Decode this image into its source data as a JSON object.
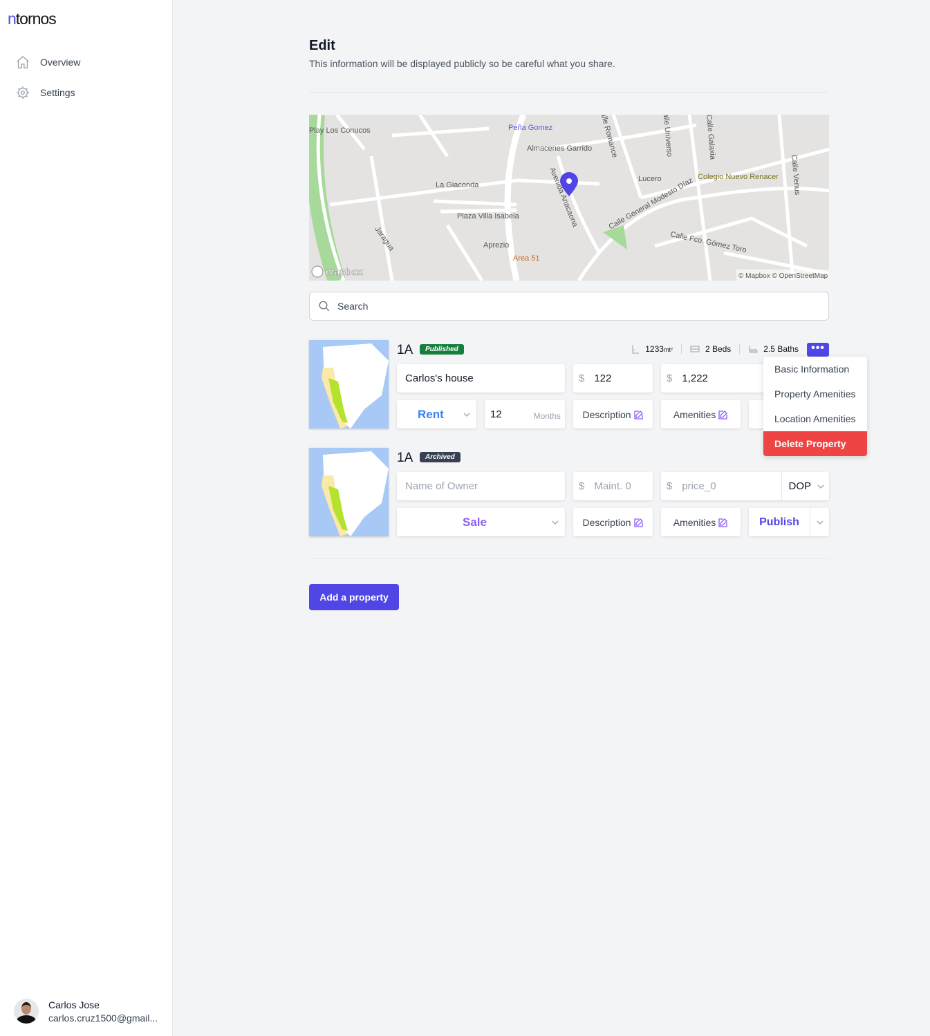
{
  "app": {
    "logo_n": "n",
    "logo_rest": "tornos"
  },
  "sidebar": {
    "items": [
      {
        "label": "Overview",
        "icon": "home-icon"
      },
      {
        "label": "Settings",
        "icon": "gear-icon"
      }
    ]
  },
  "user": {
    "name": "Carlos Jose",
    "email": "carlos.cruz1500@gmail..."
  },
  "header": {
    "title": "Edit",
    "subtitle": "This information will be displayed publicly so be careful what you share."
  },
  "map": {
    "labels": [
      "Play Los Conucos",
      "Peña Gomez",
      "Almacenes Garrido",
      "Calle Romance",
      "Calle Universo",
      "Calle Galaxia",
      "Calle Venus",
      "La Giaconda",
      "Avenida Anacaona",
      "Lucero",
      "Colegio Nuevo Renacer",
      "Calle General Modesto Díaz",
      "Plaza Villa Isabela",
      "Jaragua",
      "Aprezio",
      "Area 51",
      "Calle Fco. Gómez Toro"
    ],
    "logo": "mapbox",
    "attribution": "© Mapbox © OpenStreetMap",
    "pin_color": "#4f46e5"
  },
  "search": {
    "placeholder": "Search"
  },
  "properties": [
    {
      "unit": "1A",
      "status": "Published",
      "status_color": "#15803d",
      "area": "1233",
      "area_unit": "mt²",
      "beds": "2 Beds",
      "baths": "2.5 Baths",
      "name": "Carlos's house",
      "maintenance": "122",
      "price": "1,222",
      "type": "Rent",
      "duration": "12",
      "duration_unit": "Months",
      "description_label": "Description",
      "amenities_label": "Amenities"
    },
    {
      "unit": "1A",
      "status": "Archived",
      "status_color": "#374151",
      "name_placeholder": "Name of Owner",
      "maintenance_placeholder": "Maint. 0",
      "price_placeholder": "price_0",
      "currency": "DOP",
      "type": "Sale",
      "description_label": "Description",
      "amenities_label": "Amenities",
      "publish_label": "Publish"
    }
  ],
  "currency_symbol": "$",
  "more_label": "•••",
  "menu": {
    "items": [
      "Basic Information",
      "Property Amenities",
      "Location Amenities"
    ],
    "delete": "Delete Property"
  },
  "add_button": "Add a property",
  "colors": {
    "accent": "#4f46e5",
    "danger": "#ef4444",
    "rent": "#3b82f6",
    "sale": "#8b5cf6"
  }
}
